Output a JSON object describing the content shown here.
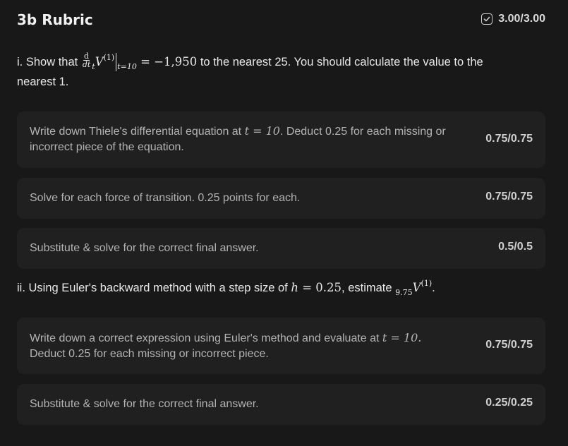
{
  "header": {
    "title": "3b Rubric",
    "score": "3.00/3.00",
    "check_icon": "checkbox-checked-icon"
  },
  "part_i": {
    "prefix": "i. Show that",
    "frac_num": "d",
    "frac_den": "dt",
    "t_sub": "t",
    "v": "V",
    "v_sup": "(1)",
    "eval_sub": "t=10",
    "eq_value": "= −1,950",
    "suffix_line1": " to the nearest 25. You should calculate the value to the",
    "suffix_line2": "nearest 1."
  },
  "criteria_i": [
    {
      "text_before": "Write down Thiele's differential equation at ",
      "math": "t = 10",
      "text_after": ". Deduct 0.25 for each missing or incorrect piece of the equation.",
      "score": "0.75/0.75"
    },
    {
      "text": "Solve for each force of transition. 0.25 points for each.",
      "score": "0.75/0.75"
    },
    {
      "text": "Substitute & solve for the correct final answer.",
      "score": "0.5/0.5"
    }
  ],
  "part_ii": {
    "prefix": "ii. Using Euler's backward method with a step size of ",
    "math_h": "h = 0.25",
    "mid": ", estimate ",
    "sub": "9.75",
    "v": "V",
    "v_sup": "(1)",
    "end": "."
  },
  "criteria_ii": [
    {
      "text_before": "Write down a correct expression using Euler's method and evaluate at ",
      "math": "t = 10.",
      "text_after": " Deduct 0.25 for each missing or incorrect piece.",
      "score": "0.75/0.75"
    },
    {
      "text": "Substitute & solve for the correct final answer.",
      "score": "0.25/0.25"
    }
  ]
}
